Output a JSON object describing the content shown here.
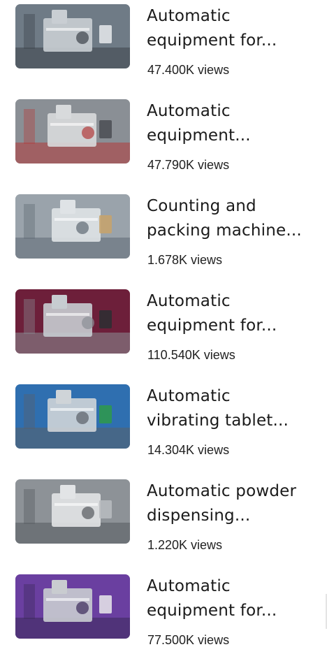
{
  "videos": [
    {
      "title_line1": "Automatic",
      "title_line2": "equipment for...",
      "views": "47.400K views",
      "thumbnail": "rotary-capsule-filling-machine",
      "palette": [
        "#6f7b86",
        "#c9ced3",
        "#3d434a",
        "#e8eaec"
      ]
    },
    {
      "title_line1": "Automatic",
      "title_line2": "equipment...",
      "views": "47.790K views",
      "thumbnail": "blister-packing-machine-closeup",
      "palette": [
        "#8a8f95",
        "#d8dadc",
        "#b23b3b",
        "#4a4e54"
      ]
    },
    {
      "title_line1": "Counting and",
      "title_line2": "packing machine...",
      "views": "1.678K views",
      "thumbnail": "counting-packing-machine-exhibition",
      "palette": [
        "#9aa3ab",
        "#dfe3e6",
        "#5f6a74",
        "#c8a36a"
      ]
    },
    {
      "title_line1": "Automatic",
      "title_line2": "equipment for...",
      "views": "110.540K views",
      "thumbnail": "coating-pan-machine",
      "palette": [
        "#6d1f3a",
        "#c7ccd1",
        "#8a8f95",
        "#2c2f33"
      ]
    },
    {
      "title_line1": "Automatic",
      "title_line2": "vibrating tablet...",
      "views": "14.304K views",
      "thumbnail": "vibrating-tablet-sorter",
      "palette": [
        "#2f6fb0",
        "#cfd4d8",
        "#5a6068",
        "#2e9a4a"
      ]
    },
    {
      "title_line1": "Automatic powder",
      "title_line2": "dispensing...",
      "views": "1.220K views",
      "thumbnail": "powder-sachet-packing-machine",
      "palette": [
        "#8d9297",
        "#e2e4e6",
        "#55595e",
        "#b9bcbf"
      ]
    },
    {
      "title_line1": "Automatic",
      "title_line2": "equipment for...",
      "views": "77.500K views",
      "thumbnail": "tablet-press-on-purple-floor",
      "palette": [
        "#6a3fa0",
        "#c9ccd0",
        "#3b2a5a",
        "#e9e9eb"
      ]
    }
  ]
}
